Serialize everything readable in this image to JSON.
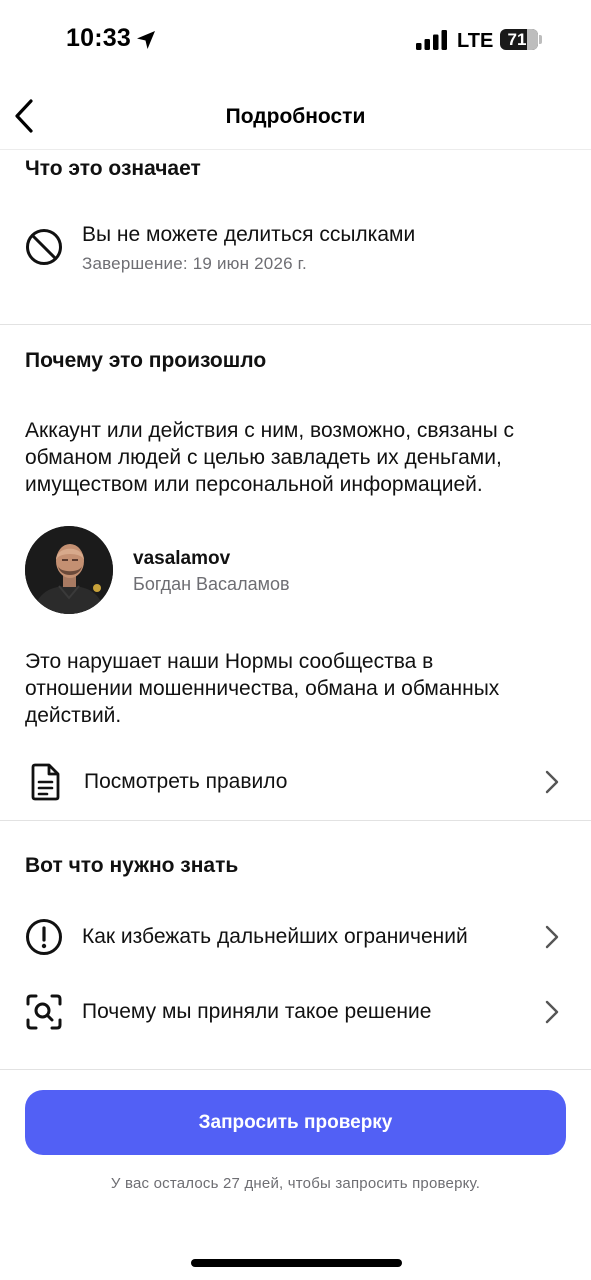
{
  "status_bar": {
    "time": "10:33",
    "network": "LTE",
    "battery": "71",
    "battery_level_percent": 71
  },
  "nav": {
    "title": "Подробности",
    "back_icon": "chevron-left-icon"
  },
  "what_it_means": {
    "title": "Что это означает",
    "restriction": {
      "icon": "block-icon",
      "text": "Вы не можете делиться ссылками",
      "end_date": "Завершение: 19 июн 2026 г."
    }
  },
  "why": {
    "title": "Почему это произошло",
    "description": [
      "Аккаунт или действия с ним, возможно, связаны с",
      "обманом людей с целью завладеть их деньгами,",
      "имуществом или персональной информацией."
    ],
    "account": {
      "username": "vasalamov",
      "full_name": "Богдан Васаламов"
    },
    "violation": [
      "Это нарушает наши Нормы сообщества в",
      "отношении мошенничества, обмана и обманных",
      "действий."
    ],
    "view_rule": {
      "icon": "document-icon",
      "label": "Посмотреть правило"
    }
  },
  "need_to_know": {
    "title": "Вот что нужно знать",
    "items": [
      {
        "icon": "alert-circle-icon",
        "label": "Как избежать дальнейших ограничений"
      },
      {
        "icon": "scan-search-icon",
        "label": "Почему мы приняли такое решение"
      }
    ]
  },
  "footer": {
    "request_button": "Запросить проверку",
    "note": "У вас осталось 27 дней, чтобы запросить проверку.",
    "accent_color": "#5260F5"
  }
}
